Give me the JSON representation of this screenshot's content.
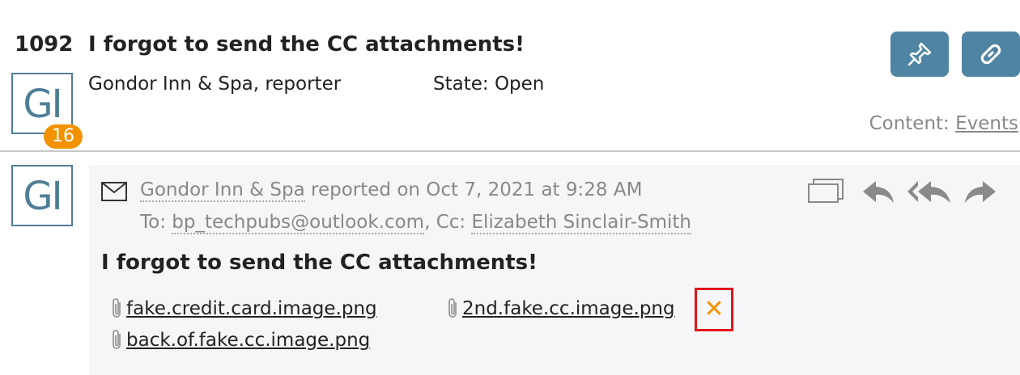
{
  "ticket": {
    "number": "1092",
    "title": "I forgot to send the CC attachments!",
    "reporter": "Gondor Inn & Spa, reporter",
    "state": "State: Open",
    "avatar_initials": "GI",
    "badge_count": "16"
  },
  "toolbar": {
    "pin_icon": "pin-icon",
    "link_icon": "link-icon"
  },
  "content": {
    "label": "Content:",
    "link": "Events"
  },
  "message": {
    "avatar_initials": "GI",
    "sender": "Gondor Inn & Spa",
    "reported_text": "reported on Oct 7, 2021 at 9:28 AM",
    "to_label": "To:",
    "to_address": "bp_techpubs@outlook.com",
    "cc_separator": ", Cc:",
    "cc_name": "Elizabeth Sinclair-Smith",
    "subject": "I forgot to send the CC attachments!",
    "actions": [
      "window-icon",
      "reply-icon",
      "reply-all-icon",
      "forward-icon"
    ],
    "attachments": [
      "fake.credit.card.image.png",
      "2nd.fake.cc.image.png",
      "back.of.fake.cc.image.png"
    ],
    "delete_symbol": "✕"
  },
  "colors": {
    "accent": "#4f84a3",
    "avatar_border": "#4f7e96",
    "badge": "#f39200",
    "highlight": "#e0141b"
  }
}
